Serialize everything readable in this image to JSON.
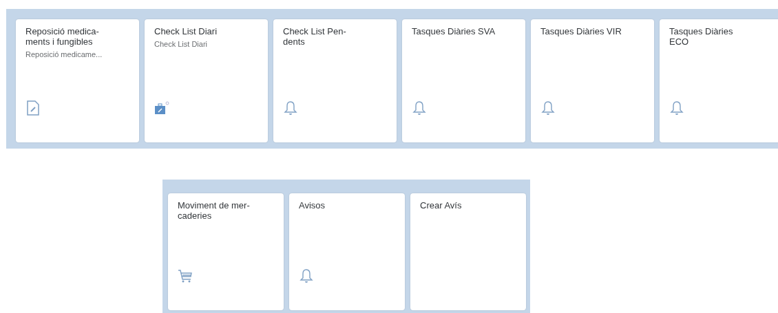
{
  "groups": [
    {
      "tiles": [
        {
          "title_lines": [
            "Reposició medica-",
            "ments i fungibles"
          ],
          "subtitle": "Reposició medicame...",
          "kind": "document"
        },
        {
          "title_lines": [
            "Check List Diari"
          ],
          "subtitle": "Check List Diari",
          "kind": "briefcase"
        },
        {
          "title_lines": [
            "Check List Pen-",
            "dents"
          ],
          "kind": "bell"
        },
        {
          "title_lines": [
            "Tasques Diàries SVA"
          ],
          "kind": "bell"
        },
        {
          "title_lines": [
            "Tasques Diàries VIR"
          ],
          "kind": "bell"
        },
        {
          "title_lines": [
            "Tasques Diàries",
            "ECO"
          ],
          "kind": "bell"
        }
      ]
    },
    {
      "tiles": [
        {
          "title_lines": [
            "Moviment de mer-",
            "caderies"
          ],
          "kind": "cart"
        },
        {
          "title_lines": [
            "Avisos"
          ],
          "kind": "bell"
        },
        {
          "title_lines": [
            "Crear Avís"
          ],
          "kind": "plain"
        }
      ]
    }
  ]
}
